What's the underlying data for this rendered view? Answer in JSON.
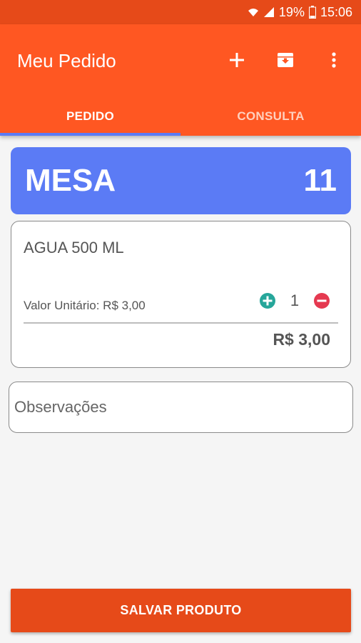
{
  "statusbar": {
    "battery": "19%",
    "time": "15:06"
  },
  "appbar": {
    "title": "Meu Pedido"
  },
  "tabs": [
    {
      "label": "PEDIDO",
      "active": true
    },
    {
      "label": "CONSULTA",
      "active": false
    }
  ],
  "mesa": {
    "label": "MESA",
    "number": "11"
  },
  "item": {
    "name": "AGUA 500 ML",
    "unit_price": "Valor Unitário: R$ 3,00",
    "quantity": "1",
    "total": "R$ 3,00"
  },
  "observacoes": {
    "placeholder": "Observações",
    "value": ""
  },
  "save_button": "SALVAR PRODUTO",
  "colors": {
    "primary": "#ff5722",
    "primary_dark": "#e64a19",
    "accent": "#5b7bf5",
    "add_green": "#26a69a",
    "remove_red": "#e53950"
  }
}
